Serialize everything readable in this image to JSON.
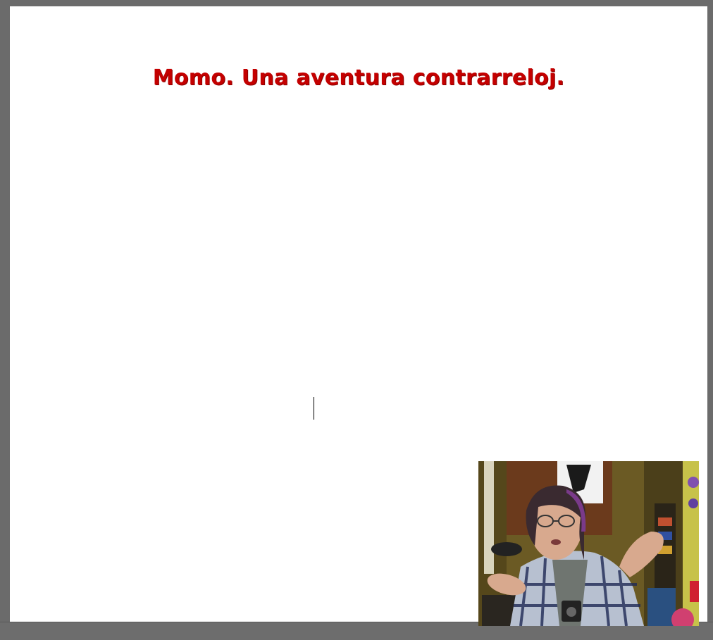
{
  "document": {
    "title": "Momo. Una aventura contrarreloj."
  },
  "colors": {
    "title": "#c40000",
    "page": "#ffffff",
    "workspace": "#6b6b6b"
  },
  "webcam_overlay": {
    "icon": "webcam-feed"
  }
}
